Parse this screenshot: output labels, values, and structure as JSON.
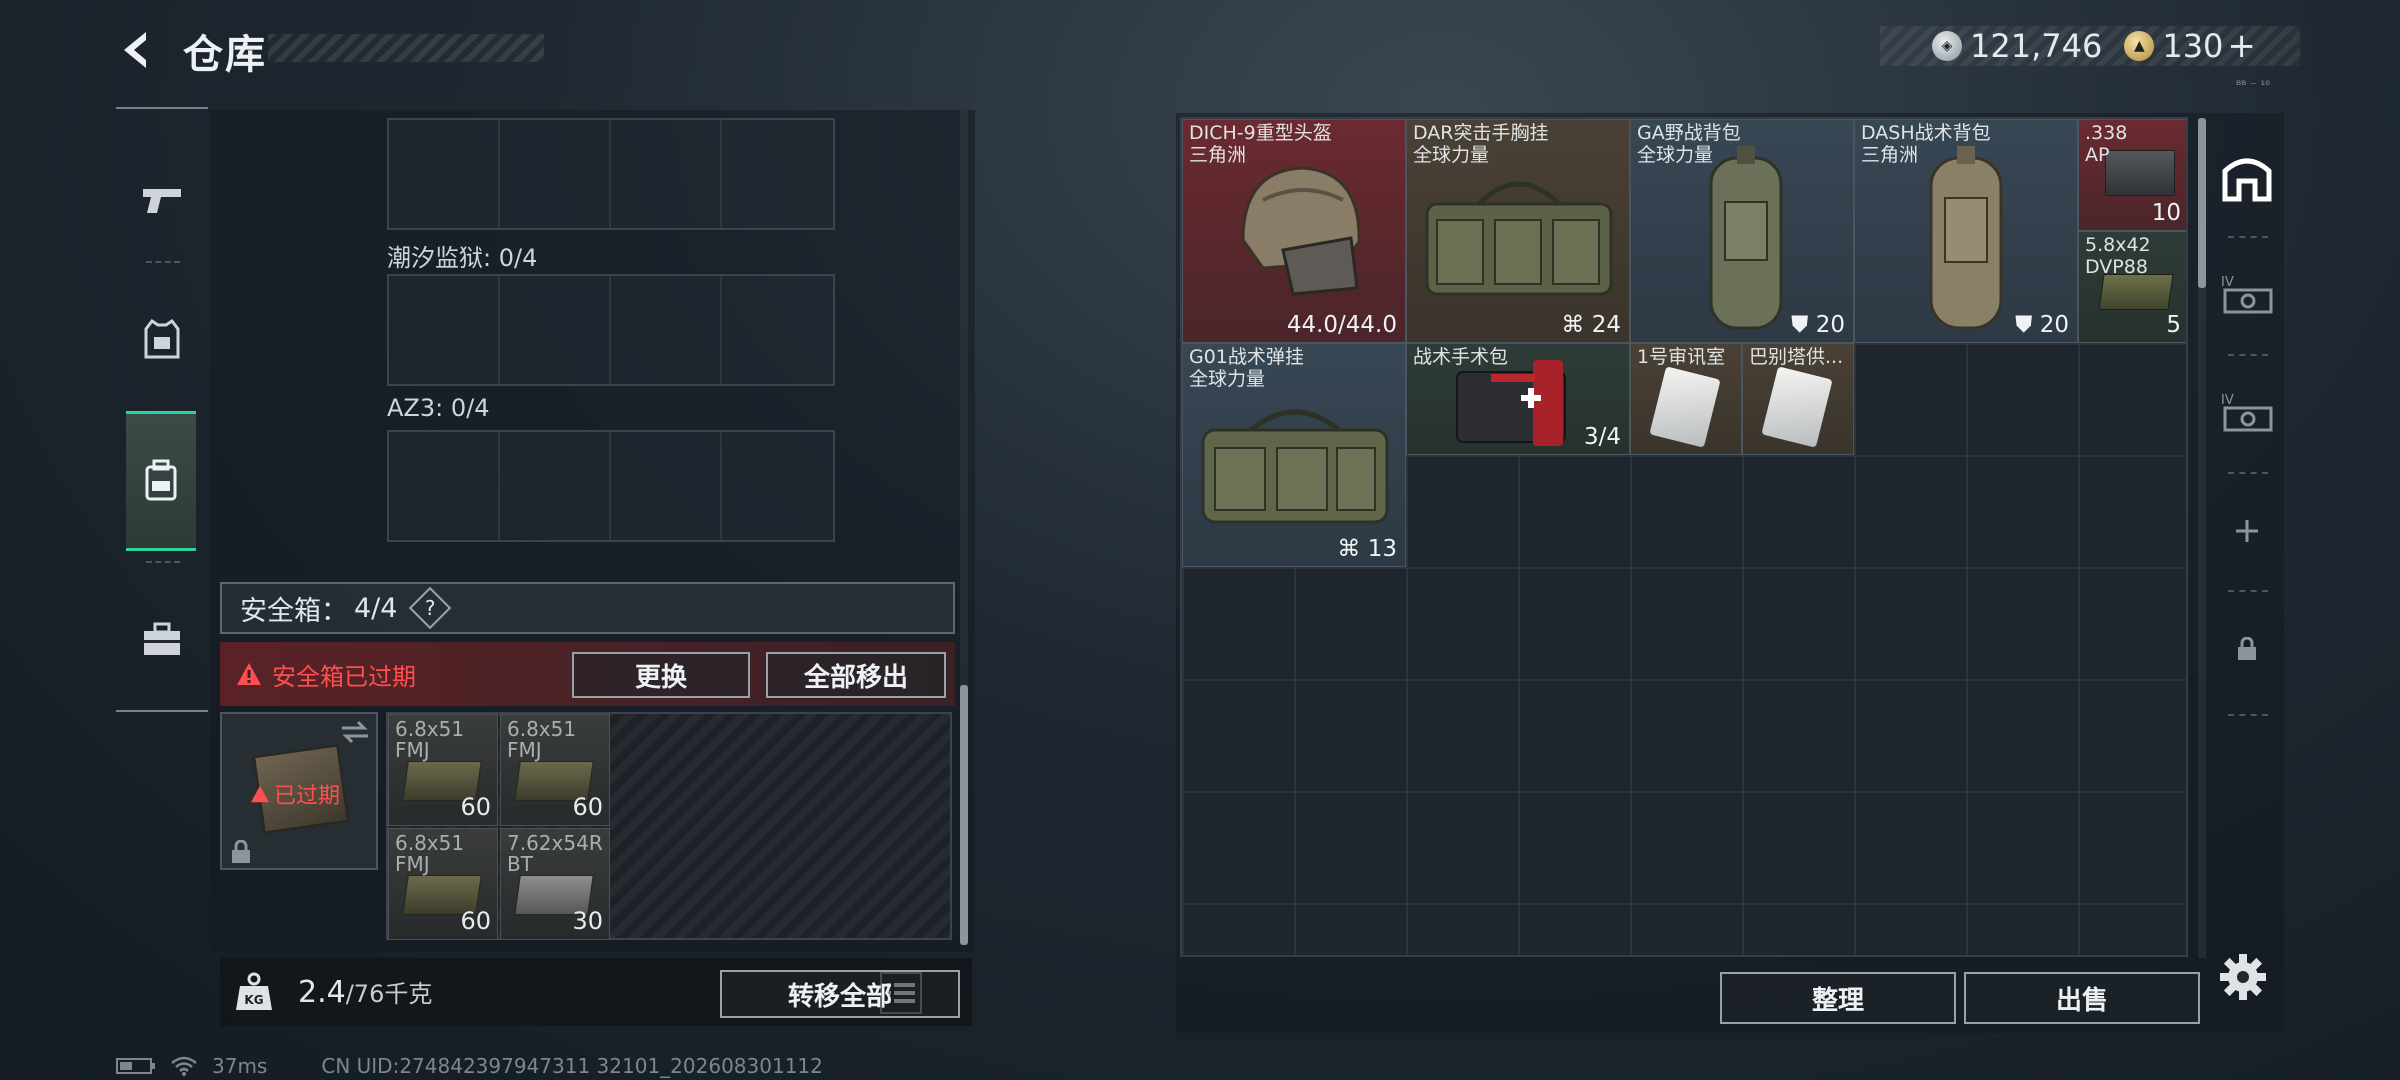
{
  "header": {
    "title": "仓库"
  },
  "currency": {
    "silver": "121,746",
    "gold": "130",
    "add_label": "+",
    "tiny_mark": "ᴮᴮ ⁻ ¹⁰"
  },
  "sections": [
    {
      "label": "潮汐监狱: 0/4"
    },
    {
      "label": "AZ3: 0/4"
    }
  ],
  "safebox": {
    "label": "安全箱：",
    "count": "4/4",
    "help": "?",
    "expired_warning": "安全箱已过期",
    "replace_label": "更换",
    "remove_all_label": "全部移出",
    "case_status": "已过期",
    "ammo": [
      {
        "name": "6.8x51\nFMJ",
        "qty": "60"
      },
      {
        "name": "6.8x51\nFMJ",
        "qty": "60"
      },
      {
        "name": "6.8x51\nFMJ",
        "qty": "60"
      },
      {
        "name": "7.62x54R\nBT",
        "qty": "30"
      }
    ]
  },
  "weight": {
    "current": "2.4",
    "max": "/76千克",
    "transfer_all_label": "转移全部"
  },
  "status": {
    "ping": "37ms",
    "uid": "CN UID:274842397947311 32101_202608301112"
  },
  "warehouse": {
    "items": [
      {
        "name": "DICH-9重型头盔",
        "sub": "三角洲",
        "qty": "44.0/44.0"
      },
      {
        "name": "DAR突击手胸挂",
        "sub": "全球力量",
        "qty": "24"
      },
      {
        "name": "GA野战背包",
        "sub": "全球力量",
        "qty": "20"
      },
      {
        "name": "DASH战术背包",
        "sub": "三角洲",
        "qty": "20"
      },
      {
        "name": ".338",
        "sub": "AP",
        "qty": "10"
      },
      {
        "name": "5.8x42",
        "sub": "DVP88",
        "qty": "5"
      },
      {
        "name": "G01战术弹挂",
        "sub": "全球力量",
        "qty": "13"
      },
      {
        "name": "战术手术包",
        "sub": "",
        "qty": "3/4"
      },
      {
        "name": "1号审讯室",
        "sub": "",
        "qty": ""
      },
      {
        "name": "巴别塔供...",
        "sub": "",
        "qty": ""
      }
    ],
    "sort_label": "整理",
    "sell_label": "出售"
  },
  "colors": {
    "accent": "#2bd3a1",
    "warning": "#ff4f4f"
  }
}
